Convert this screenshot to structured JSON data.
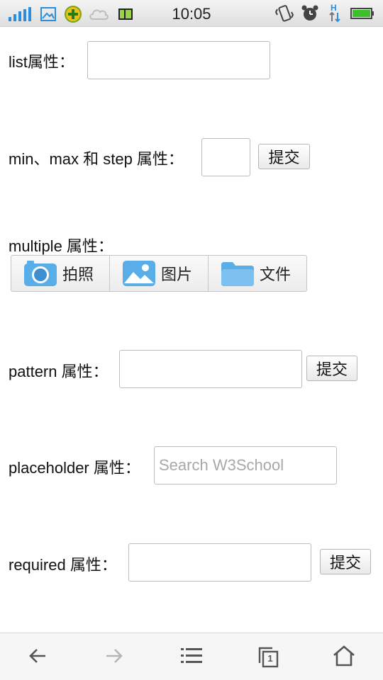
{
  "status_bar": {
    "time": "10:05",
    "icons": [
      "signal-icon",
      "image-icon",
      "app-badge-icon",
      "cloud-icon",
      "battery-small-icon",
      "vibrate-icon",
      "alarm-icon",
      "data-transfer-icon",
      "battery-icon"
    ]
  },
  "form": {
    "list_label": "list属性：",
    "minmax_label": "min、max 和 step 属性：",
    "minmax_submit": "提交",
    "multiple_label": "multiple 属性：",
    "picker": {
      "camera": "拍照",
      "gallery": "图片",
      "file": "文件"
    },
    "pattern_label": "pattern 属性：",
    "pattern_submit": "提交",
    "placeholder_label": "placeholder 属性：",
    "placeholder_text": "Search W3School",
    "required_label": "required 属性：",
    "required_submit": "提交"
  },
  "nav": {
    "icons": [
      "back-arrow-icon",
      "forward-arrow-icon",
      "menu-list-icon",
      "tabs-icon",
      "home-icon"
    ],
    "tab_count": "1"
  },
  "colors": {
    "accent_blue": "#4a9fe0",
    "statusbar_bg": "#e6e6e6"
  }
}
